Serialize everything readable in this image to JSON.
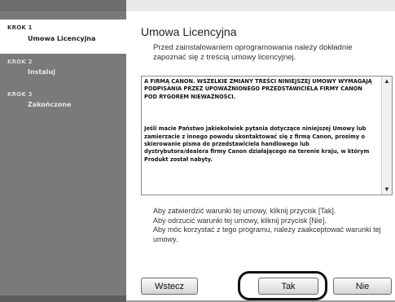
{
  "sidebar": {
    "steps": [
      {
        "number": "KROK 1",
        "label": "Umowa Licencyjna",
        "active": true
      },
      {
        "number": "KROK 2",
        "label": "Instaluj",
        "active": false
      },
      {
        "number": "KROK 3",
        "label": "Zakończone",
        "active": false
      }
    ]
  },
  "main": {
    "title": "Umowa Licencyjna",
    "subtitle": "Przed zainstalowaniem oprogramowania należy dokładnie zapoznać się z treścią umowy licencyjnej.",
    "license": {
      "paragraphs": [
        "A FIRMĄ CANON. WSZELKIE ZMIANY TREŚCI NINIEJSZEJ UMOWY WYMAGAJĄ PODPISANIA PRZEZ UPOWAŻNIONEGO PRZEDSTAWICIELA FIRMY CANON POD RYGOREM NIEWAŻNOŚCI.",
        "Jeśli macie Państwo jakiekolwiek pytania dotyczące niniejszej Umowy lub zamierzacie z innego powodu skontaktować się z firmą Canon, prosimy o skierowanie pisma do przedstawiciela handlowego lub dystrybutora/dealera firmy Canon działającego na terenie kraju, w którym Produkt został nabyty."
      ]
    },
    "instructions": [
      "Aby zatwierdzić warunki tej umowy, kliknij przycisk [Tak].",
      "Aby odrzucić warunki tej umowy, kliknij przycisk [Nie].",
      "Aby móc korzystać z tego programu, należy zaakceptować warunki tej umowy."
    ]
  },
  "buttons": {
    "back": "Wstecz",
    "yes": "Tak",
    "no": "Nie"
  },
  "icons": {
    "scroll_up": "triangle-up",
    "scroll_down": "triangle-down"
  }
}
